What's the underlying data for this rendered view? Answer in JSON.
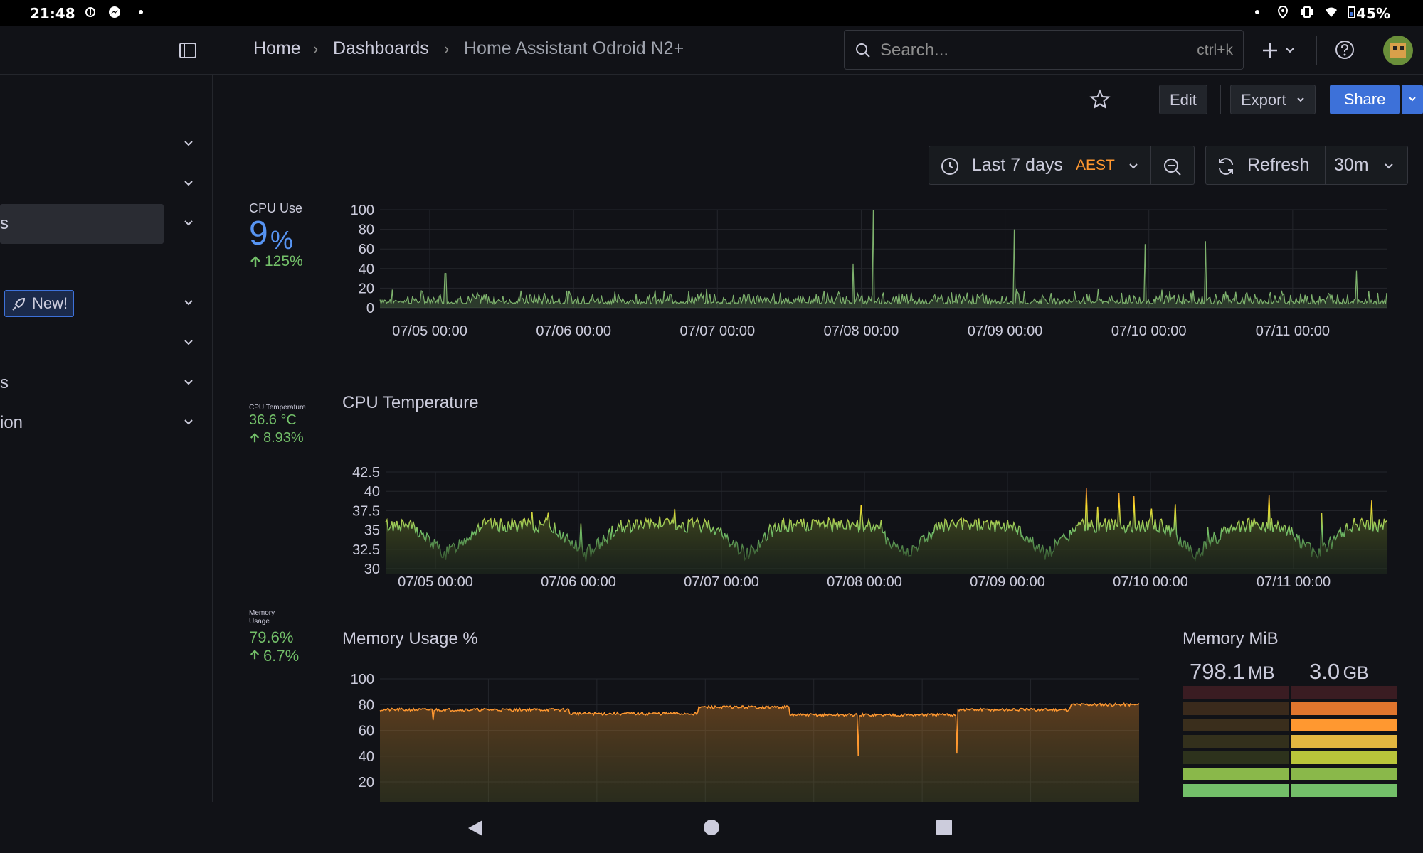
{
  "status_bar": {
    "time": "21:48",
    "battery": "45%"
  },
  "breadcrumb": [
    "Home",
    "Dashboards",
    "Home Assistant Odroid N2+"
  ],
  "search": {
    "placeholder": "Search...",
    "shortcut": "ctrl+k"
  },
  "toolbar": {
    "edit": "Edit",
    "export": "Export",
    "share": "Share"
  },
  "time_picker": {
    "range": "Last 7 days",
    "timezone": "AEST",
    "refresh": "Refresh",
    "interval": "30m"
  },
  "sidebar": {
    "items": [
      {
        "label": ""
      },
      {
        "label": ""
      },
      {
        "label": "s"
      },
      {
        "label": ""
      },
      {
        "label": ""
      },
      {
        "label": "s"
      },
      {
        "label": "ion"
      }
    ],
    "new_badge": "New!"
  },
  "stats": {
    "cpu": {
      "title": "CPU Use",
      "value": "9",
      "unit": "%",
      "delta": "125%"
    },
    "temp": {
      "title": "CPU Temperature",
      "value": "36.6 °C",
      "delta": "8.93%"
    },
    "memory": {
      "title": "Memory Usage",
      "value": "79.6%",
      "delta": "6.7%"
    }
  },
  "memory_mib": {
    "title": "Memory MiB",
    "used_value": "798.1",
    "used_unit": "MB",
    "total_value": "3.0",
    "total_unit": "GB",
    "used_fraction": 0.26,
    "total_fraction": 0.9
  },
  "colors": {
    "accent": "#3d71d9",
    "green": "#73bf69",
    "orange": "#ff9830",
    "cpu_blue": "#5794f2",
    "yellow": "#fade2a"
  },
  "chart_data": [
    {
      "type": "line",
      "title": "",
      "x_ticks": [
        "07/05 00:00",
        "07/06 00:00",
        "07/07 00:00",
        "07/08 00:00",
        "07/09 00:00",
        "07/10 00:00",
        "07/11 00:00"
      ],
      "y_ticks": [
        "100",
        "80",
        "60",
        "40",
        "20",
        "0"
      ],
      "ylim": [
        0,
        100
      ],
      "series": [
        {
          "color": "#7eb26d",
          "baseline": 4,
          "noise": 10,
          "spikes": [
            [
              0.49,
              100
            ],
            [
              0.47,
              45
            ],
            [
              0.63,
              80
            ],
            [
              0.76,
              65
            ],
            [
              0.82,
              68
            ],
            [
              0.065,
              35
            ],
            [
              0.97,
              38
            ]
          ]
        }
      ]
    },
    {
      "type": "area",
      "title": "CPU Temperature",
      "x_ticks": [
        "07/05 00:00",
        "07/06 00:00",
        "07/07 00:00",
        "07/08 00:00",
        "07/09 00:00",
        "07/10 00:00",
        "07/11 00:00"
      ],
      "y_ticks": [
        "42.5",
        "40",
        "37.5",
        "35",
        "32.5",
        "30"
      ],
      "ylim": [
        28,
        43
      ],
      "series": [
        {
          "baseline": 34.5,
          "noise": 2.2,
          "dips": [
            0.06,
            0.2,
            0.36,
            0.52,
            0.66,
            0.81,
            0.93
          ]
        }
      ]
    },
    {
      "type": "area",
      "title": "Memory Usage %",
      "x_ticks": [],
      "y_ticks": [
        "100",
        "80",
        "60",
        "40",
        "20"
      ],
      "ylim": [
        0,
        100
      ],
      "series": [
        {
          "color": "#ff9830",
          "segments": [
            [
              0,
              0.25,
              76
            ],
            [
              0.25,
              0.42,
              73
            ],
            [
              0.42,
              0.54,
              78
            ],
            [
              0.54,
              0.76,
              72
            ],
            [
              0.76,
              0.91,
              76
            ],
            [
              0.91,
              1,
              80
            ]
          ]
        }
      ]
    }
  ]
}
